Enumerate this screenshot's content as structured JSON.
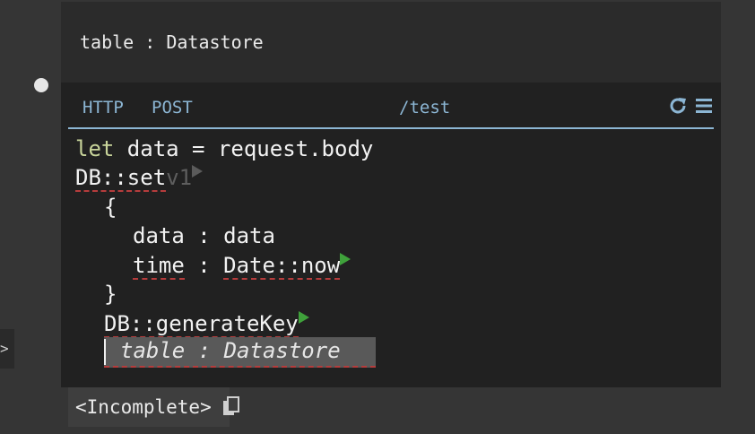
{
  "db_header": {
    "title": "table : Datastore"
  },
  "gutter": {
    "expand_label": ">"
  },
  "handler": {
    "method_type": "HTTP",
    "method": "POST",
    "route": "/test",
    "icons": [
      "refresh-icon",
      "hamburger-menu-icon"
    ]
  },
  "code": {
    "l1_kw": "let",
    "l1_rest": " data = request.body",
    "l2_fn": "DB::set",
    "l2_version": "v1",
    "l3": "{",
    "l4_key": "data",
    "l4_sep": " : ",
    "l4_val": "data",
    "l5_key": "time",
    "l5_sep": " : ",
    "l5_val": "Date::now",
    "l6": "}",
    "l7_fn": "DB::generateKey",
    "l8_placeholder": "table : Datastore"
  },
  "result": {
    "text": "<Incomplete>",
    "icon": "copy-icon"
  },
  "colors": {
    "background": "#353535",
    "handler_bg": "#212121",
    "accent_blue": "#8cb6d4",
    "keyword": "#c8d49a",
    "error_underline": "#b53c3c",
    "play_green": "#3fa13b"
  }
}
